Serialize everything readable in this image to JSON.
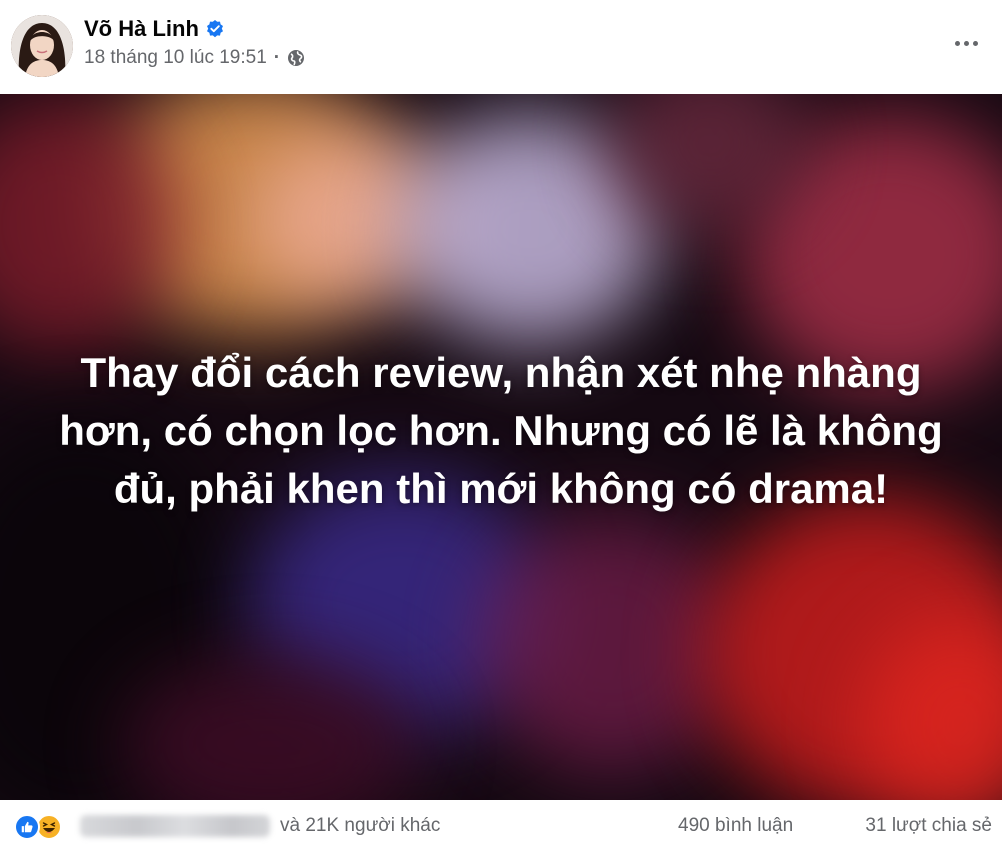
{
  "post": {
    "author": "Võ Hà Linh",
    "timestamp": "18 tháng 10 lúc 19:51",
    "separator": "·",
    "privacy_icon": "globe-icon",
    "verified_icon": "verified-badge-icon",
    "more_icon": "more-options-icon",
    "media_text": "Thay đổi cách review, nhận xét nhẹ nhàng hơn, có chọn lọc hơn. Nhưng có lẽ là không đủ, phải khen thì mới không có drama!"
  },
  "footer": {
    "reaction_icons": [
      "like-icon",
      "haha-icon"
    ],
    "others_text": "và 21K người khác",
    "comments_text": "490 bình luận",
    "shares_text": "31 lượt chia sẻ"
  },
  "colors": {
    "accent": "#1877f2",
    "secondary_text": "#65676b",
    "primary_text": "#050505"
  }
}
